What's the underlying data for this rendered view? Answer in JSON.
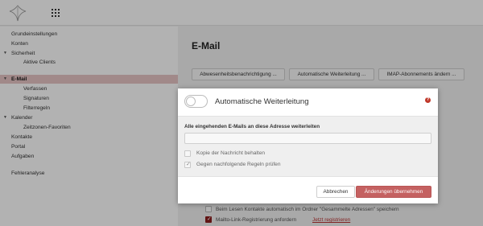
{
  "header": {
    "logo_icon": "bird-logo-icon",
    "apps_icon": "app-grid-icon"
  },
  "sidebar": {
    "items": [
      {
        "label": "Grundeinstellungen"
      },
      {
        "label": "Konten"
      },
      {
        "label": "Sicherheit",
        "caret": "▼"
      },
      {
        "label": "Aktive Clients"
      },
      {
        "label": "E-Mail",
        "caret": "▼",
        "active": true
      },
      {
        "label": "Verfassen"
      },
      {
        "label": "Signaturen"
      },
      {
        "label": "Filterregeln"
      },
      {
        "label": "Kalender",
        "caret": "▼"
      },
      {
        "label": "Zeitzonen-Favoriten"
      },
      {
        "label": "Kontakte"
      },
      {
        "label": "Portal"
      },
      {
        "label": "Aufgaben"
      },
      {
        "label": "Fehleranalyse"
      }
    ]
  },
  "main": {
    "title": "E-Mail",
    "toolbar": [
      {
        "label": "Abwesenheitsbenachrichtigung ..."
      },
      {
        "label": "Automatische Weiterleitung ..."
      },
      {
        "label": "IMAP-Abonnements ändern ..."
      }
    ],
    "bottom_options": [
      {
        "label": "Beim Lesen Kontakte automatisch im Ordner \"Gesammelte Adressen\" speichern",
        "checked": false
      },
      {
        "label": "Mailto-Link-Registrierung anfordern",
        "checked": true,
        "link": "Jetzt registrieren"
      }
    ]
  },
  "modal": {
    "title": "Automatische Weiterleitung",
    "toggle_on": false,
    "help_icon": "help-icon",
    "help_glyph": "?",
    "field_label": "Alle eingehenden E-Mails an diese Adresse weiterleiten",
    "address_value": "",
    "options": [
      {
        "label": "Kopie der Nachricht behalten",
        "checked": false
      },
      {
        "label": "Gegen nachfolgende Regeln prüfen",
        "checked": true
      }
    ],
    "cancel_label": "Abbrechen",
    "save_label": "Änderungen übernehmen"
  },
  "colors": {
    "accent": "#c46161",
    "active_nav_bg": "#e7c4c4",
    "checkbox_on": "#8b1d1d"
  }
}
